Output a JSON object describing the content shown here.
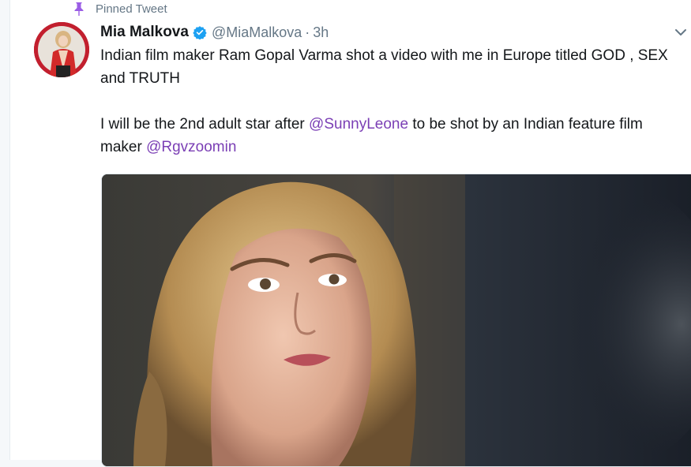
{
  "pinned": {
    "label": "Pinned Tweet",
    "icon": "pin-icon"
  },
  "tweet": {
    "display_name": "Mia Malkova",
    "verified_icon": "verified-badge-icon",
    "handle": "@MiaMalkova",
    "separator": "·",
    "time": "3h",
    "menu_icon": "chevron-down-icon",
    "text1": "Indian film maker Ram Gopal Varma shot a video with me in Europe titled GOD , SEX and TRUTH",
    "text2_before": "I will be the 2nd adult star after ",
    "mention1": "@SunnyLeone",
    "text2_middle": " to be shot by an Indian feature film maker ",
    "mention2": "@Rgvzoomin"
  },
  "colors": {
    "accent": "#7b3fb5",
    "verified": "#1da1f2",
    "muted": "#657786",
    "text": "#14171a"
  }
}
